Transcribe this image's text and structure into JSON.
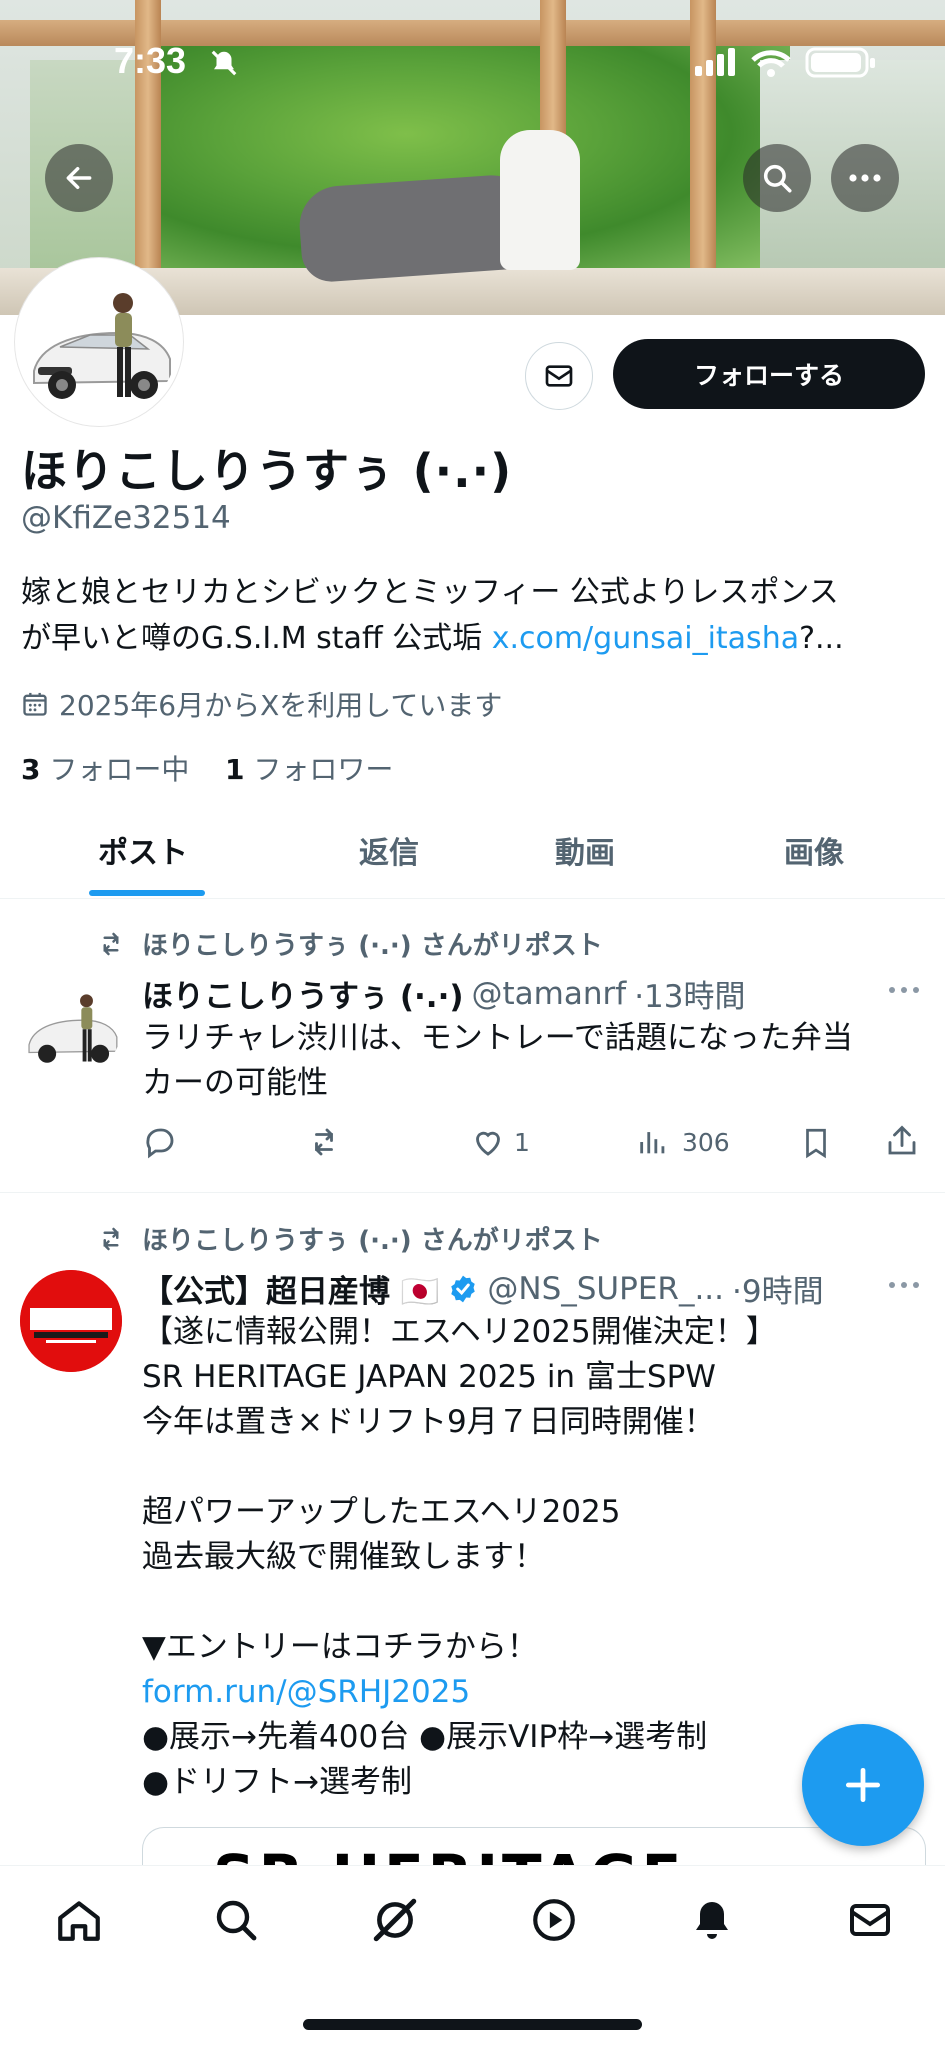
{
  "status_bar": {
    "time": "7:33"
  },
  "profile": {
    "display_name": "ほりこしりうすぅ (·.·)",
    "handle": "@KfiZe32514",
    "bio_line1": "嫁と娘とセリカとシビックとミッフィー 公式よりレスポンス",
    "bio_line2_prefix": "が早いと噂のG.S.I.M staff 公式垢 ",
    "bio_link": "x.com/gunsai_itasha",
    "bio_link_suffix": "?...",
    "joined": "2025年6月からXを利用しています",
    "following_count": "3",
    "following_label": "フォロー中",
    "followers_count": "1",
    "followers_label": "フォロワー",
    "follow_button": "フォローする"
  },
  "tabs": [
    {
      "label": "ポスト",
      "active": true
    },
    {
      "label": "返信"
    },
    {
      "label": "動画"
    },
    {
      "label": "画像"
    }
  ],
  "posts": [
    {
      "repost_label": "ほりこしりうすぅ (·.·) さんがリポスト",
      "author": "ほりこしりうすぅ (·.·)",
      "handle": "@tamanrf",
      "time": "·13時間",
      "text_line1": "ラリチャレ渋川は、モントレーで話題になった弁当",
      "text_line2": "カーの可能性",
      "likes": "1",
      "views": "306"
    },
    {
      "repost_label": "ほりこしりうすぅ (·.·) さんがリポスト",
      "author": "【公式】超日産博 🇯🇵",
      "handle": "@NS_SUPER_...",
      "time": "·9時間",
      "text": [
        "【遂に情報公開！エスヘリ2025開催決定！】",
        "SR HERITAGE JAPAN 2025 in 富士SPW",
        "今年は置き×ドリフト9月７日同時開催！",
        "",
        "超パワーアップしたエスヘリ2025",
        "過去最大級で開催致します！",
        "",
        "▼エントリーはコチラから！"
      ],
      "link": "form.run/@SRHJ2025",
      "text_after": [
        "●展示→先着400台 ●展示VIP枠→選考制",
        "●ドリフト→選考制"
      ],
      "card_text": "SR HERITAGE JAPAN"
    }
  ],
  "colors": {
    "accent": "#1d9bf0",
    "text": "#0f1419",
    "muted": "#536471"
  }
}
